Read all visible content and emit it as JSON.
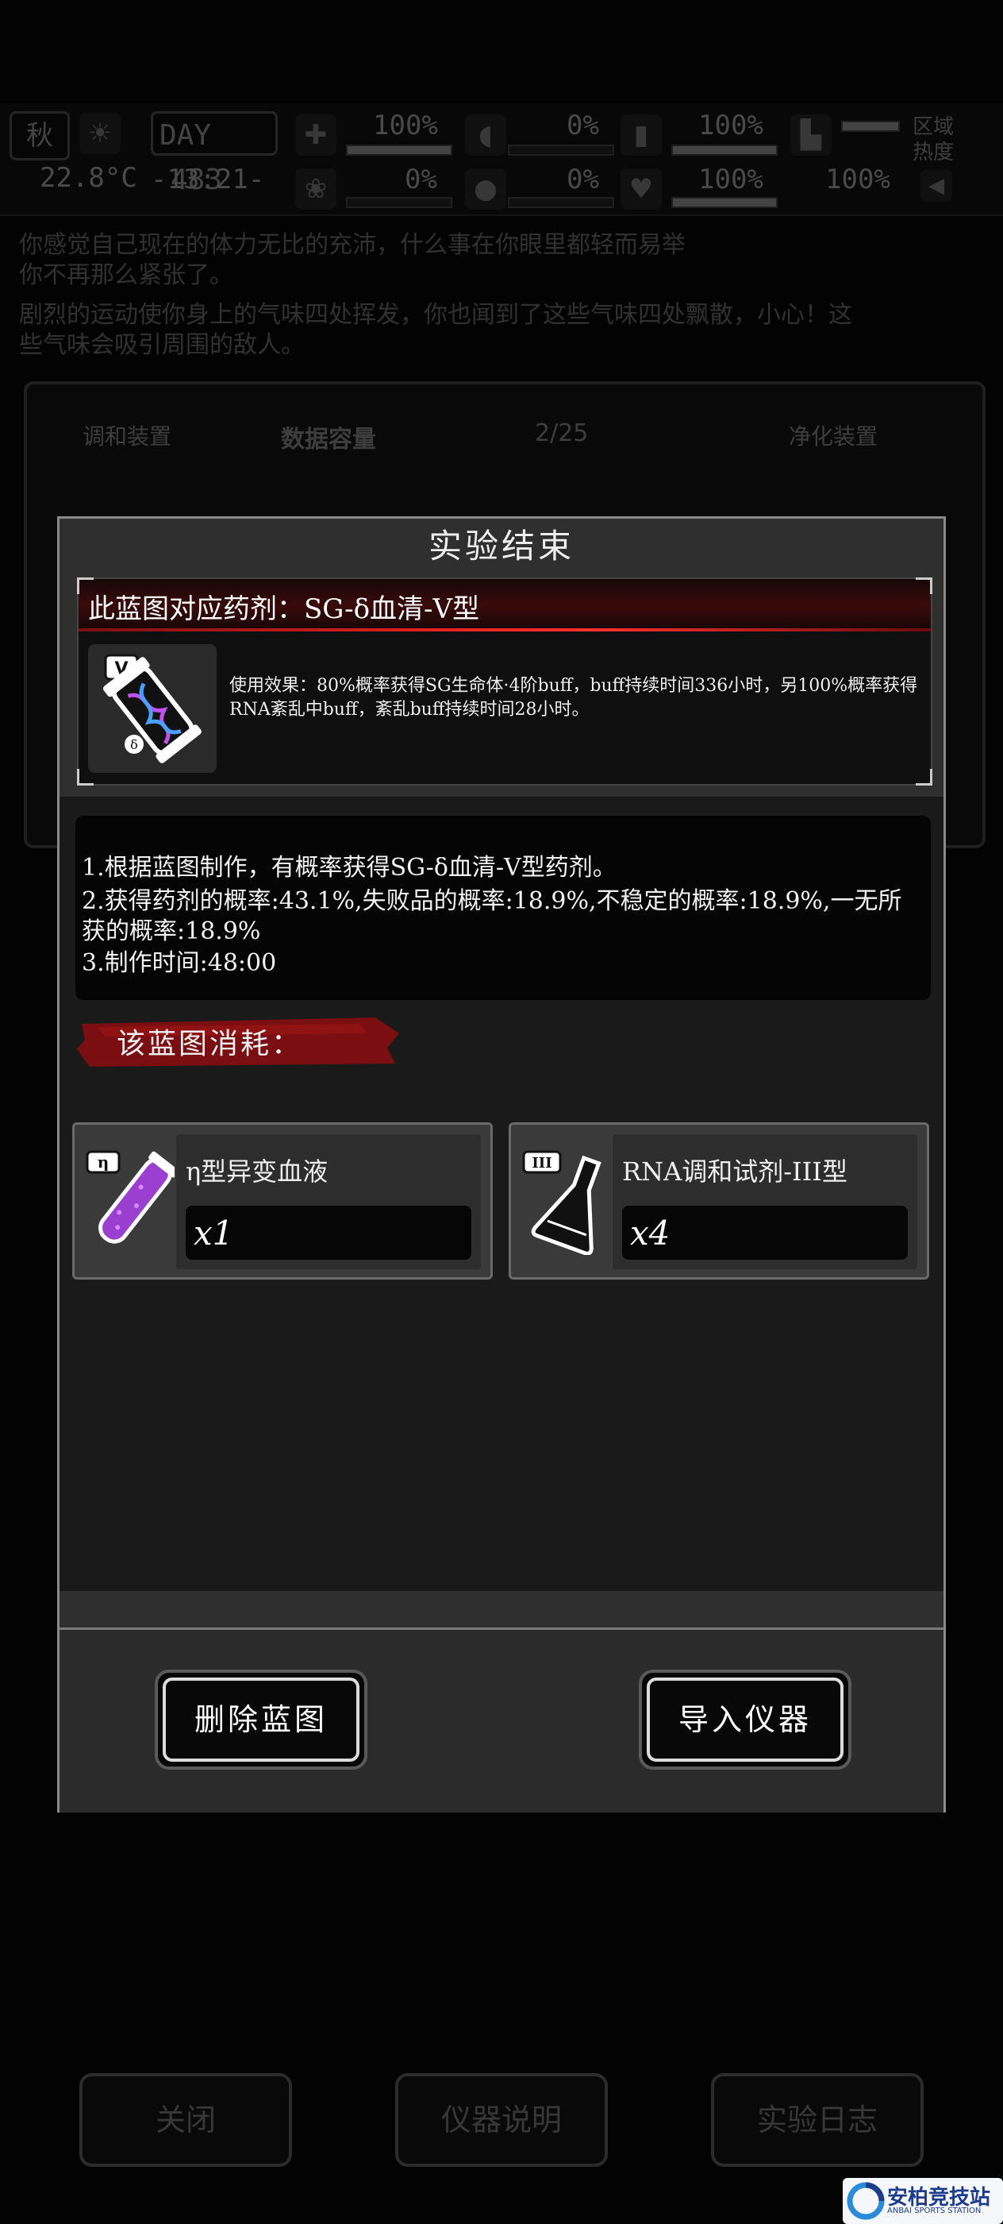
{
  "background": {
    "season": "秋",
    "day_label": "DAY",
    "day_number": "483",
    "temperature": "22.8°C",
    "clock": "-13:21-",
    "region_label": "区域热度",
    "stats": [
      {
        "name": "health-kit",
        "value": "100%",
        "level": 1.0
      },
      {
        "name": "stomach",
        "value": "0%",
        "level": 0.0
      },
      {
        "name": "capsule",
        "value": "100%",
        "level": 1.0
      },
      {
        "name": "boot",
        "value": "",
        "level": 1.0
      },
      {
        "name": "brain",
        "value": "0%",
        "level": 0.0
      },
      {
        "name": "blood",
        "value": "0%",
        "level": 0.0
      },
      {
        "name": "heart",
        "value": "100%",
        "level": 1.0
      },
      {
        "name": "stamina",
        "value": "100%",
        "level": 1.0
      }
    ],
    "log_lines": [
      "你感觉自己现在的体力无比的充沛，什么事在你眼里都轻而易举",
      "你不再那么紧张了。",
      "剧烈的运动使你身上的气味四处挥发，你也闻到了这些气味四处飘散，小心！这",
      "些气味会吸引周围的敌人。"
    ],
    "panel_left_label": "调和装置",
    "panel_mid_label": "数据容量",
    "panel_capacity": "2/25",
    "panel_right_label": "净化装置",
    "bottom_buttons": [
      "关闭",
      "仪器说明",
      "实验日志"
    ]
  },
  "modal": {
    "title": "实验结束",
    "blueprint_title": "此蓝图对应药剂：SG-δ血清-V型",
    "potion_badge": "V",
    "effect_text": "使用效果：80%概率获得SG生命体·4阶buff，buff持续时间336小时，另100%概率获得RNA紊乱中buff，紊乱buff持续时间28小时。",
    "info_lines": [
      "1.根据蓝图制作，有概率获得SG-δ血清-V型药剂。",
      "2.获得药剂的概率:43.1%,失败品的概率:18.9%,不稳定的概率:18.9%,一无所",
      "获的概率:18.9%",
      "3.制作时间:48:00"
    ],
    "consume_label": "该蓝图消耗：",
    "materials": [
      {
        "badge": "η",
        "name": "η型异变血液",
        "qty": "x1"
      },
      {
        "badge": "III",
        "name": "RNA调和试剂-III型",
        "qty": "x4"
      }
    ],
    "delete_button": "删除蓝图",
    "import_button": "导入仪器"
  },
  "watermark": {
    "main": "安柏竞技站",
    "sub": "ANBAI SPORTS STATION"
  },
  "colors": {
    "accent_red": "#e02020",
    "modal_bg": "#2f2f2f",
    "vial_purple": "#b04de0"
  }
}
